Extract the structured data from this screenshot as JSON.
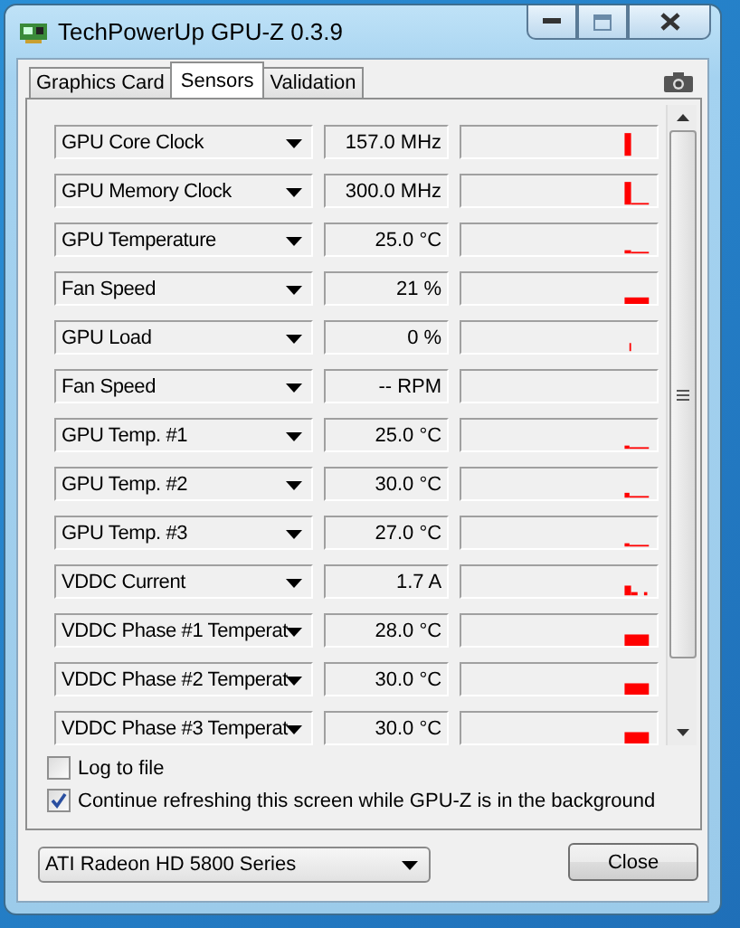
{
  "window": {
    "title": "TechPowerUp GPU-Z 0.3.9"
  },
  "tabs": [
    {
      "label": "Graphics Card",
      "selected": false
    },
    {
      "label": "Sensors",
      "selected": true
    },
    {
      "label": "Validation",
      "selected": false
    }
  ],
  "sensors": [
    {
      "name": "GPU Core Clock",
      "value": "157.0 MHz"
    },
    {
      "name": "GPU Memory Clock",
      "value": "300.0 MHz"
    },
    {
      "name": "GPU Temperature",
      "value": "25.0 °C"
    },
    {
      "name": "Fan Speed",
      "value": "21 %"
    },
    {
      "name": "GPU Load",
      "value": "0 %"
    },
    {
      "name": "Fan Speed",
      "value": "-- RPM"
    },
    {
      "name": "GPU Temp. #1",
      "value": "25.0 °C"
    },
    {
      "name": "GPU Temp. #2",
      "value": "30.0 °C"
    },
    {
      "name": "GPU Temp. #3",
      "value": "27.0 °C"
    },
    {
      "name": "VDDC Current",
      "value": "1.7 A"
    },
    {
      "name": "VDDC Phase #1 Temperat",
      "value": "28.0 °C"
    },
    {
      "name": "VDDC Phase #2 Temperat",
      "value": "30.0 °C"
    },
    {
      "name": "VDDC Phase #3 Temperat",
      "value": "30.0 °C"
    }
  ],
  "options": [
    {
      "label": "Log to file",
      "checked": false
    },
    {
      "label": "Continue refreshing this screen while GPU-Z is in the background",
      "checked": true
    }
  ],
  "device": {
    "value": "ATI Radeon HD 5800 Series"
  },
  "buttons": [
    "Close"
  ]
}
